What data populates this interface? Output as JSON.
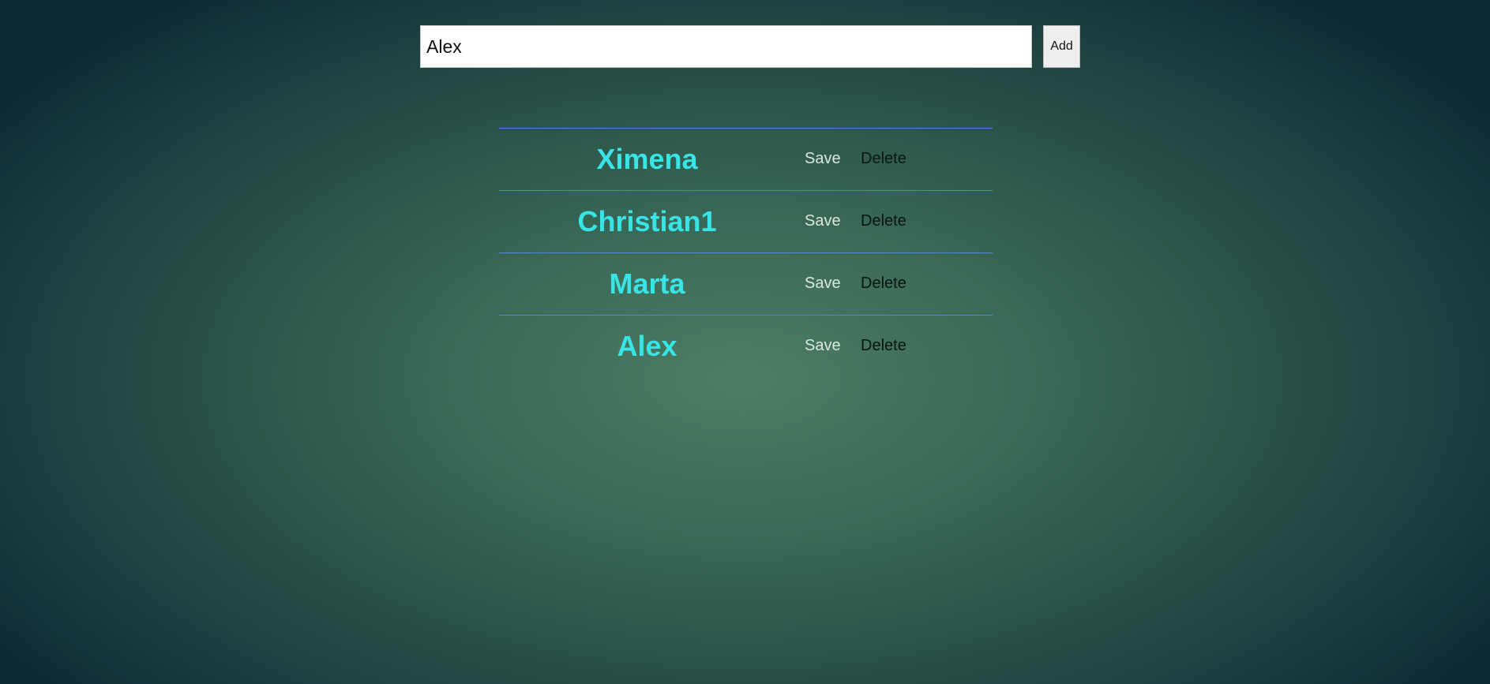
{
  "form": {
    "input_value": "Alex",
    "add_label": "Add"
  },
  "people": [
    {
      "name": "Ximena",
      "save_label": "Save",
      "delete_label": "Delete"
    },
    {
      "name": "Christian1",
      "save_label": "Save",
      "delete_label": "Delete"
    },
    {
      "name": "Marta",
      "save_label": "Save",
      "delete_label": "Delete"
    },
    {
      "name": "Alex",
      "save_label": "Save",
      "delete_label": "Delete"
    }
  ],
  "colors": {
    "name_text": "#39e4e6",
    "row_divider": "#4f86d6",
    "save_text": "#dbe6df",
    "delete_text": "#0a1512"
  }
}
